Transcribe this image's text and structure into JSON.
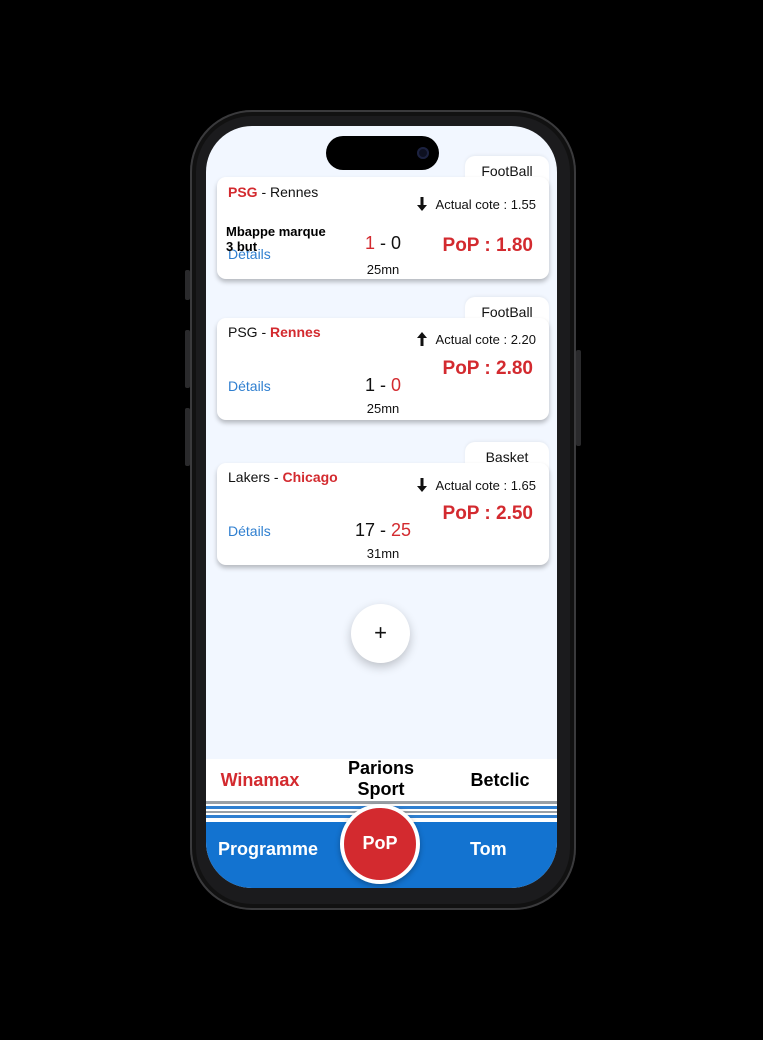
{
  "matches": [
    {
      "sport": "FootBall",
      "home": "PSG",
      "sep": " - ",
      "away": "Rennes",
      "cote_label": "Actual cote : 1.55",
      "trend": "down",
      "details": "Détails",
      "bet_text": "Mbappe marque 3 but",
      "score_home": "1",
      "score_sep": " - ",
      "score_away": "0",
      "minute": "25mn",
      "pop": "PoP : 1.80"
    },
    {
      "sport": "FootBall",
      "home": "PSG",
      "sep": " - ",
      "away": "Rennes",
      "cote_label": "Actual cote : 2.20",
      "trend": "up",
      "details": "Détails",
      "score_home": "1",
      "score_sep": " - ",
      "score_away": "0",
      "minute": "25mn",
      "pop": "PoP : 2.80"
    },
    {
      "sport": "Basket",
      "home": "Lakers",
      "sep": " - ",
      "away": "Chicago",
      "cote_label": "Actual cote : 1.65",
      "trend": "down",
      "details": "Détails",
      "score_home": "17",
      "score_sep": " - ",
      "score_away": "25",
      "minute": "31mn",
      "pop": "PoP : 2.50"
    }
  ],
  "fab_label": "+",
  "bookmakers": [
    "Winamax",
    "Parions Sport",
    "Betclic"
  ],
  "nav": {
    "left": "Programme",
    "center": "PoP",
    "right": "Tom"
  },
  "colors": {
    "accent": "#d32a2f",
    "link": "#2f7fd0",
    "nav": "#1373d0",
    "background": "#f2f7ff"
  }
}
